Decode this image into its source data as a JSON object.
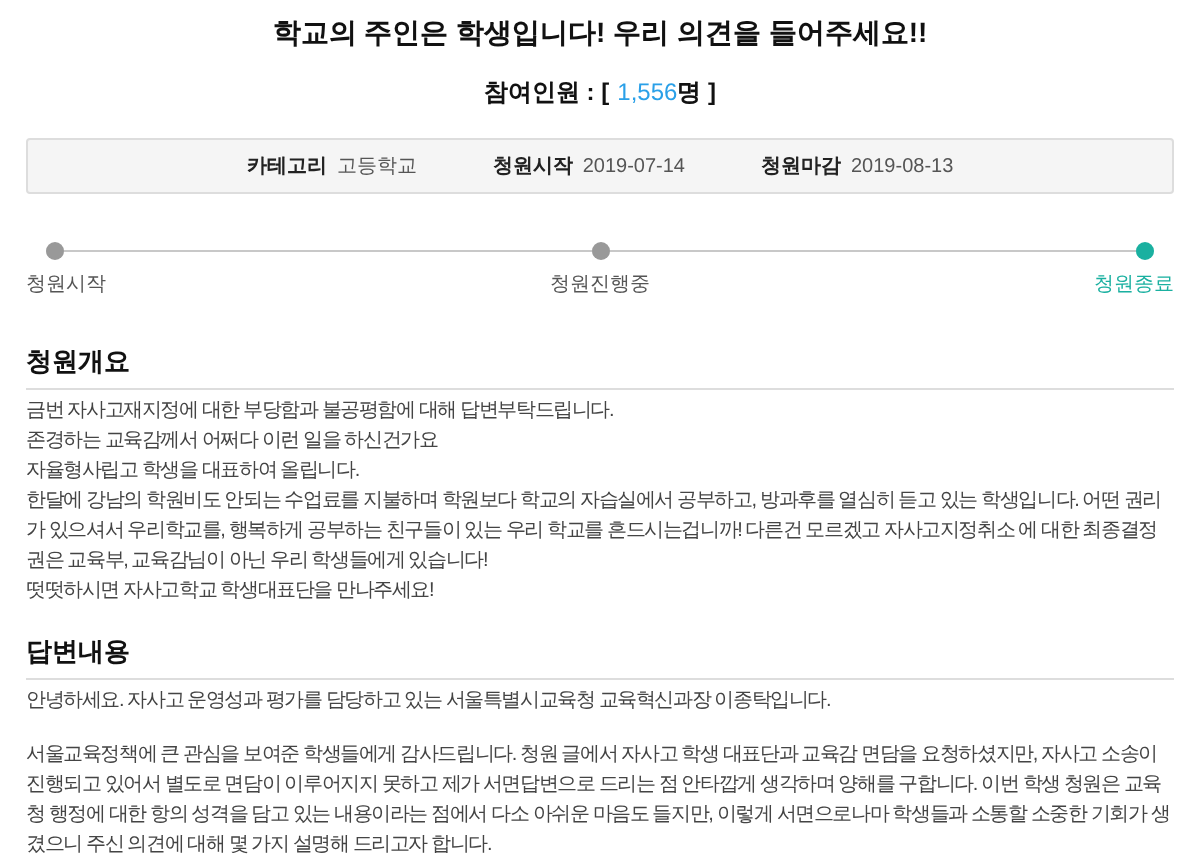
{
  "title": "학교의 주인은 학생입니다! 우리 의견을 들어주세요!!",
  "participants": {
    "label": "참여인원 : [",
    "count": "1,556",
    "unit": "명 ]"
  },
  "info": [
    {
      "label": "카테고리",
      "value": "고등학교"
    },
    {
      "label": "청원시작",
      "value": "2019-07-14"
    },
    {
      "label": "청원마감",
      "value": "2019-08-13"
    }
  ],
  "stages": [
    {
      "label": "청원시작",
      "selected": false
    },
    {
      "label": "청원진행중",
      "selected": false
    },
    {
      "label": "청원종료",
      "selected": true
    }
  ],
  "sections": [
    {
      "heading": "청원개요",
      "paragraphs": [
        "금번 자사고재지정에 대한 부당함과 불공평함에 대해 답변부탁드립니다.",
        "존경하는 교육감께서 어쩌다 이런 일을 하신건가요",
        "자율형사립고 학생을 대표하여 올립니다.",
        "한달에 강남의 학원비도 안되는 수업료를 지불하며 학원보다 학교의 자습실에서 공부하고, 방과후를 열심히 듣고 있는 학생입니다. 어떤 권리가 있으셔서 우리학교를, 행복하게 공부하는 친구들이 있는 우리 학교를 흔드시는겁니까! 다른건 모르겠고 자사고지정취소 에 대한 최종결정권은 교육부, 교육감님이 아닌 우리 학생들에게 있습니다!",
        "떳떳하시면 자사고학교 학생대표단을 만나주세요!"
      ]
    },
    {
      "heading": "답변내용",
      "paragraphs": [
        "안녕하세요. 자사고 운영성과 평가를 담당하고 있는 서울특별시교육청 교육혁신과장 이종탁입니다.",
        "서울교육정책에 큰 관심을 보여준 학생들에게 감사드립니다. 청원 글에서 자사고 학생 대표단과 교육감 면담을 요청하셨지만, 자사고 소송이 진행되고 있어서 별도로 면담이 이루어지지 못하고 제가 서면답변으로 드리는 점 안타깝게 생각하며 양해를 구합니다. 이번 학생 청원은 교육청 행정에 대한 항의 성격을 담고 있는 내용이라는 점에서 다소 아쉬운 마음도 들지만, 이렇게 서면으로나마 학생들과 소통할 소중한 기회가 생겼으니 주신 의견에 대해 몇 가지 설명해 드리고자 합니다."
      ]
    }
  ]
}
